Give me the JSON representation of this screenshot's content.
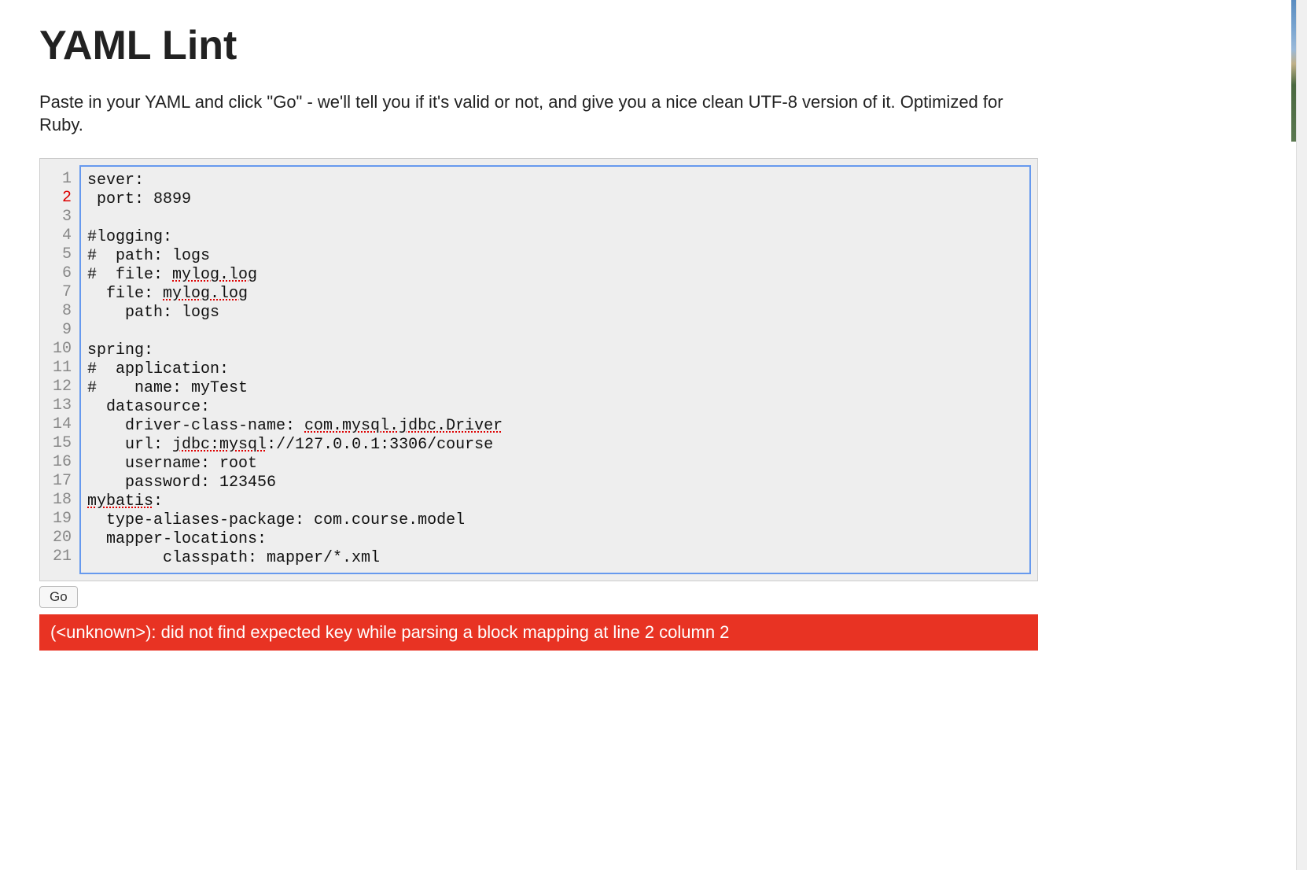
{
  "header": {
    "title": "YAML Lint",
    "description": "Paste in your YAML and click \"Go\" - we'll tell you if it's valid or not, and give you a nice clean UTF-8 version of it. Optimized for Ruby."
  },
  "editor": {
    "error_line": 2,
    "lines": [
      {
        "num": 1,
        "text": "sever:"
      },
      {
        "num": 2,
        "text": " port: 8899"
      },
      {
        "num": 3,
        "text": ""
      },
      {
        "num": 4,
        "text": "#logging:"
      },
      {
        "num": 5,
        "text": "#  path: logs"
      },
      {
        "num": 6,
        "text_parts": [
          "#  file: ",
          {
            "spell": "mylog.log"
          }
        ]
      },
      {
        "num": 7,
        "text_parts": [
          "  file: ",
          {
            "spell": "mylog.log"
          }
        ]
      },
      {
        "num": 8,
        "text": "    path: logs"
      },
      {
        "num": 9,
        "text": ""
      },
      {
        "num": 10,
        "text": "spring:"
      },
      {
        "num": 11,
        "text": "#  application:"
      },
      {
        "num": 12,
        "text": "#    name: myTest"
      },
      {
        "num": 13,
        "text": "  datasource:"
      },
      {
        "num": 14,
        "text_parts": [
          "    driver-class-name: ",
          {
            "spell": "com.mysql.jdbc.Driver"
          }
        ]
      },
      {
        "num": 15,
        "text_parts": [
          "    url: ",
          {
            "spell": "jdbc:mysql"
          },
          "://127.0.0.1:3306/course"
        ]
      },
      {
        "num": 16,
        "text": "    username: root"
      },
      {
        "num": 17,
        "text": "    password: 123456"
      },
      {
        "num": 18,
        "text_parts": [
          {
            "spell": "mybatis"
          },
          ":"
        ]
      },
      {
        "num": 19,
        "text": "  type-aliases-package: com.course.model"
      },
      {
        "num": 20,
        "text": "  mapper-locations:"
      },
      {
        "num": 21,
        "text": "        classpath: mapper/*.xml"
      }
    ]
  },
  "controls": {
    "go_label": "Go"
  },
  "result": {
    "error_message": "(<unknown>): did not find expected key while parsing a block mapping at line 2 column 2"
  }
}
